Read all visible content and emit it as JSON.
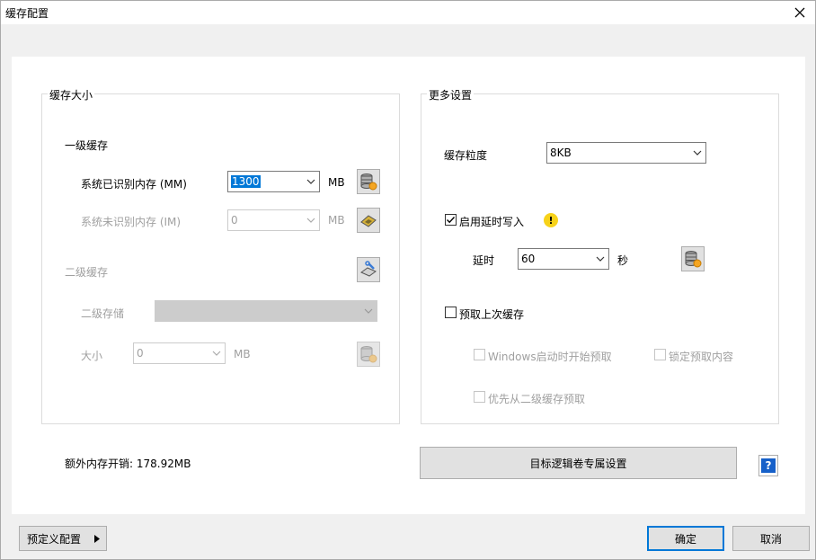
{
  "window": {
    "title": "缓存配置"
  },
  "cache_size_group": {
    "title": "缓存大小",
    "l1_label": "一级缓存",
    "recognized_mem_label": "系统已识别内存 (MM)",
    "recognized_mem_value": "1300",
    "recognized_mem_unit": "MB",
    "unrecognized_mem_label": "系统未识别内存 (IM)",
    "unrecognized_mem_value": "0",
    "unrecognized_mem_unit": "MB",
    "l2_label": "二级缓存",
    "l2_storage_label": "二级存储",
    "l2_storage_value": "",
    "l2_size_label": "大小",
    "l2_size_value": "0",
    "l2_size_unit": "MB"
  },
  "more_settings_group": {
    "title": "更多设置",
    "granularity_label": "缓存粒度",
    "granularity_value": "8KB",
    "deferred_write_label": "启用延时写入",
    "deferred_write_checked": true,
    "delay_label": "延时",
    "delay_value": "60",
    "delay_unit": "秒",
    "prefetch_label": "预取上次缓存",
    "prefetch_checked": false,
    "prefetch_on_start_label": "Windows启动时开始预取",
    "lock_prefetch_label": "锁定预取内容",
    "prefer_l2_label": "优先从二级缓存预取"
  },
  "overhead_text": "额外内存开销: 178.92MB",
  "volume_settings_button": "目标逻辑卷专属设置",
  "footer": {
    "preset_button": "预定义配置",
    "ok_button": "确定",
    "cancel_button": "取消"
  },
  "colors": {
    "accent": "#0078d7",
    "warning": "#f7d21a",
    "help_blue": "#1660c9"
  }
}
